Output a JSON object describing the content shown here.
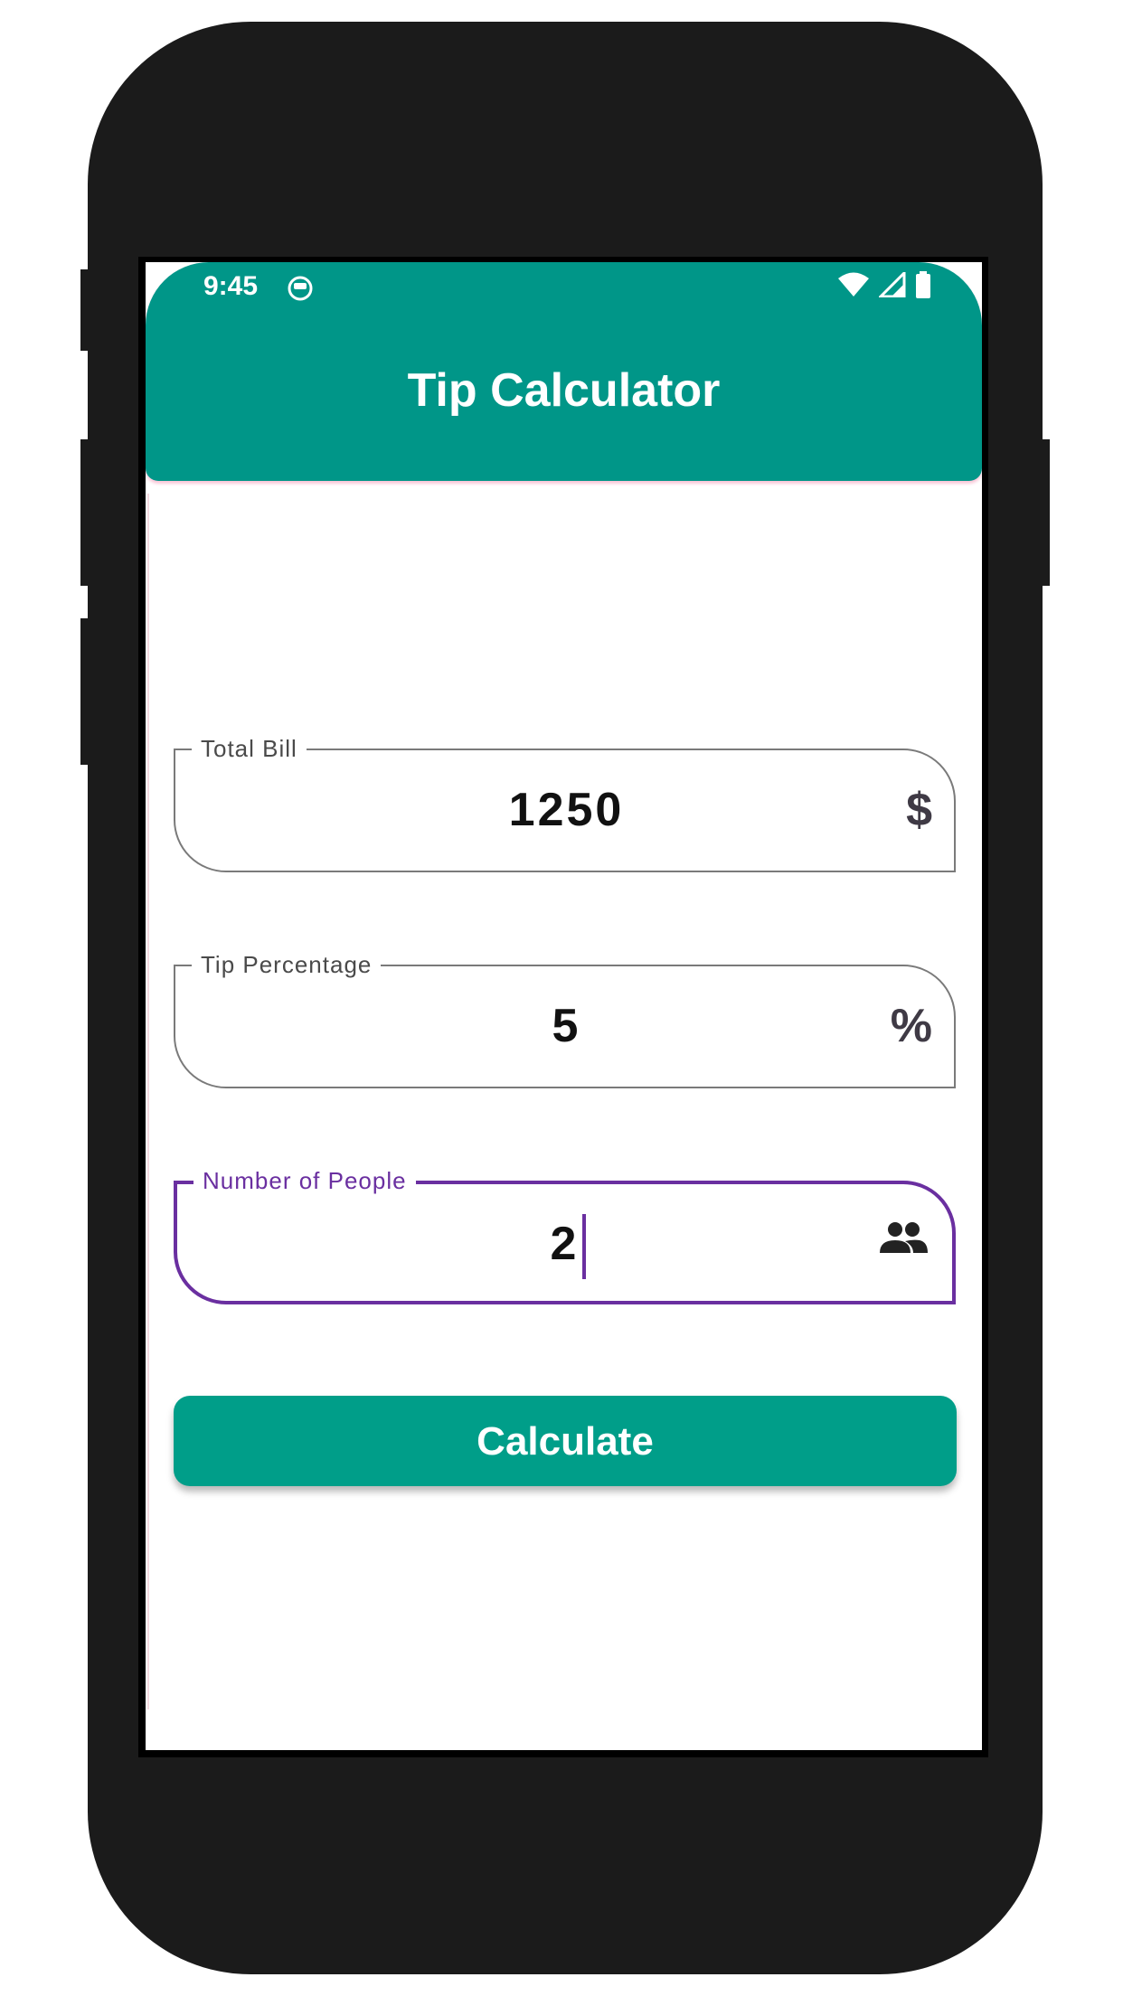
{
  "status_bar": {
    "time": "9:45"
  },
  "app_bar": {
    "title": "Tip Calculator"
  },
  "form": {
    "total_bill": {
      "label": "Total Bill",
      "value": "1250",
      "icon_text": "$",
      "icon": "dollar-icon"
    },
    "tip_percentage": {
      "label": "Tip Percentage",
      "value": "5",
      "icon_text": "%",
      "icon": "percent-icon"
    },
    "number_of_people": {
      "label": "Number of People",
      "value": "2",
      "icon": "people-icon",
      "focused": true
    },
    "calculate_label": "Calculate"
  },
  "colors": {
    "primary": "#009688",
    "button": "#009e89",
    "focus": "#6a2fa0"
  }
}
